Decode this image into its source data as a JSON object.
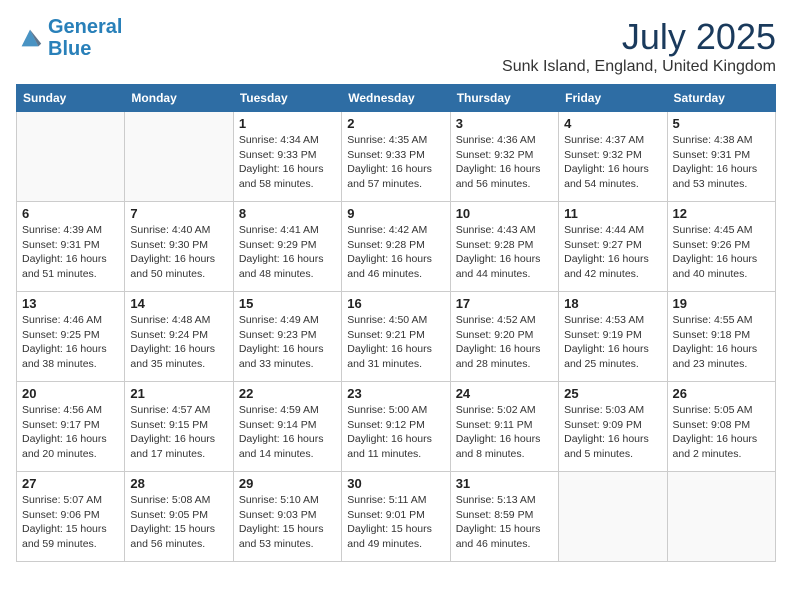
{
  "header": {
    "logo_line1": "General",
    "logo_line2": "Blue",
    "title": "July 2025",
    "subtitle": "Sunk Island, England, United Kingdom"
  },
  "calendar": {
    "days_of_week": [
      "Sunday",
      "Monday",
      "Tuesday",
      "Wednesday",
      "Thursday",
      "Friday",
      "Saturday"
    ],
    "weeks": [
      [
        {
          "day": "",
          "info": ""
        },
        {
          "day": "",
          "info": ""
        },
        {
          "day": "1",
          "info": "Sunrise: 4:34 AM\nSunset: 9:33 PM\nDaylight: 16 hours and 58 minutes."
        },
        {
          "day": "2",
          "info": "Sunrise: 4:35 AM\nSunset: 9:33 PM\nDaylight: 16 hours and 57 minutes."
        },
        {
          "day": "3",
          "info": "Sunrise: 4:36 AM\nSunset: 9:32 PM\nDaylight: 16 hours and 56 minutes."
        },
        {
          "day": "4",
          "info": "Sunrise: 4:37 AM\nSunset: 9:32 PM\nDaylight: 16 hours and 54 minutes."
        },
        {
          "day": "5",
          "info": "Sunrise: 4:38 AM\nSunset: 9:31 PM\nDaylight: 16 hours and 53 minutes."
        }
      ],
      [
        {
          "day": "6",
          "info": "Sunrise: 4:39 AM\nSunset: 9:31 PM\nDaylight: 16 hours and 51 minutes."
        },
        {
          "day": "7",
          "info": "Sunrise: 4:40 AM\nSunset: 9:30 PM\nDaylight: 16 hours and 50 minutes."
        },
        {
          "day": "8",
          "info": "Sunrise: 4:41 AM\nSunset: 9:29 PM\nDaylight: 16 hours and 48 minutes."
        },
        {
          "day": "9",
          "info": "Sunrise: 4:42 AM\nSunset: 9:28 PM\nDaylight: 16 hours and 46 minutes."
        },
        {
          "day": "10",
          "info": "Sunrise: 4:43 AM\nSunset: 9:28 PM\nDaylight: 16 hours and 44 minutes."
        },
        {
          "day": "11",
          "info": "Sunrise: 4:44 AM\nSunset: 9:27 PM\nDaylight: 16 hours and 42 minutes."
        },
        {
          "day": "12",
          "info": "Sunrise: 4:45 AM\nSunset: 9:26 PM\nDaylight: 16 hours and 40 minutes."
        }
      ],
      [
        {
          "day": "13",
          "info": "Sunrise: 4:46 AM\nSunset: 9:25 PM\nDaylight: 16 hours and 38 minutes."
        },
        {
          "day": "14",
          "info": "Sunrise: 4:48 AM\nSunset: 9:24 PM\nDaylight: 16 hours and 35 minutes."
        },
        {
          "day": "15",
          "info": "Sunrise: 4:49 AM\nSunset: 9:23 PM\nDaylight: 16 hours and 33 minutes."
        },
        {
          "day": "16",
          "info": "Sunrise: 4:50 AM\nSunset: 9:21 PM\nDaylight: 16 hours and 31 minutes."
        },
        {
          "day": "17",
          "info": "Sunrise: 4:52 AM\nSunset: 9:20 PM\nDaylight: 16 hours and 28 minutes."
        },
        {
          "day": "18",
          "info": "Sunrise: 4:53 AM\nSunset: 9:19 PM\nDaylight: 16 hours and 25 minutes."
        },
        {
          "day": "19",
          "info": "Sunrise: 4:55 AM\nSunset: 9:18 PM\nDaylight: 16 hours and 23 minutes."
        }
      ],
      [
        {
          "day": "20",
          "info": "Sunrise: 4:56 AM\nSunset: 9:17 PM\nDaylight: 16 hours and 20 minutes."
        },
        {
          "day": "21",
          "info": "Sunrise: 4:57 AM\nSunset: 9:15 PM\nDaylight: 16 hours and 17 minutes."
        },
        {
          "day": "22",
          "info": "Sunrise: 4:59 AM\nSunset: 9:14 PM\nDaylight: 16 hours and 14 minutes."
        },
        {
          "day": "23",
          "info": "Sunrise: 5:00 AM\nSunset: 9:12 PM\nDaylight: 16 hours and 11 minutes."
        },
        {
          "day": "24",
          "info": "Sunrise: 5:02 AM\nSunset: 9:11 PM\nDaylight: 16 hours and 8 minutes."
        },
        {
          "day": "25",
          "info": "Sunrise: 5:03 AM\nSunset: 9:09 PM\nDaylight: 16 hours and 5 minutes."
        },
        {
          "day": "26",
          "info": "Sunrise: 5:05 AM\nSunset: 9:08 PM\nDaylight: 16 hours and 2 minutes."
        }
      ],
      [
        {
          "day": "27",
          "info": "Sunrise: 5:07 AM\nSunset: 9:06 PM\nDaylight: 15 hours and 59 minutes."
        },
        {
          "day": "28",
          "info": "Sunrise: 5:08 AM\nSunset: 9:05 PM\nDaylight: 15 hours and 56 minutes."
        },
        {
          "day": "29",
          "info": "Sunrise: 5:10 AM\nSunset: 9:03 PM\nDaylight: 15 hours and 53 minutes."
        },
        {
          "day": "30",
          "info": "Sunrise: 5:11 AM\nSunset: 9:01 PM\nDaylight: 15 hours and 49 minutes."
        },
        {
          "day": "31",
          "info": "Sunrise: 5:13 AM\nSunset: 8:59 PM\nDaylight: 15 hours and 46 minutes."
        },
        {
          "day": "",
          "info": ""
        },
        {
          "day": "",
          "info": ""
        }
      ]
    ]
  }
}
